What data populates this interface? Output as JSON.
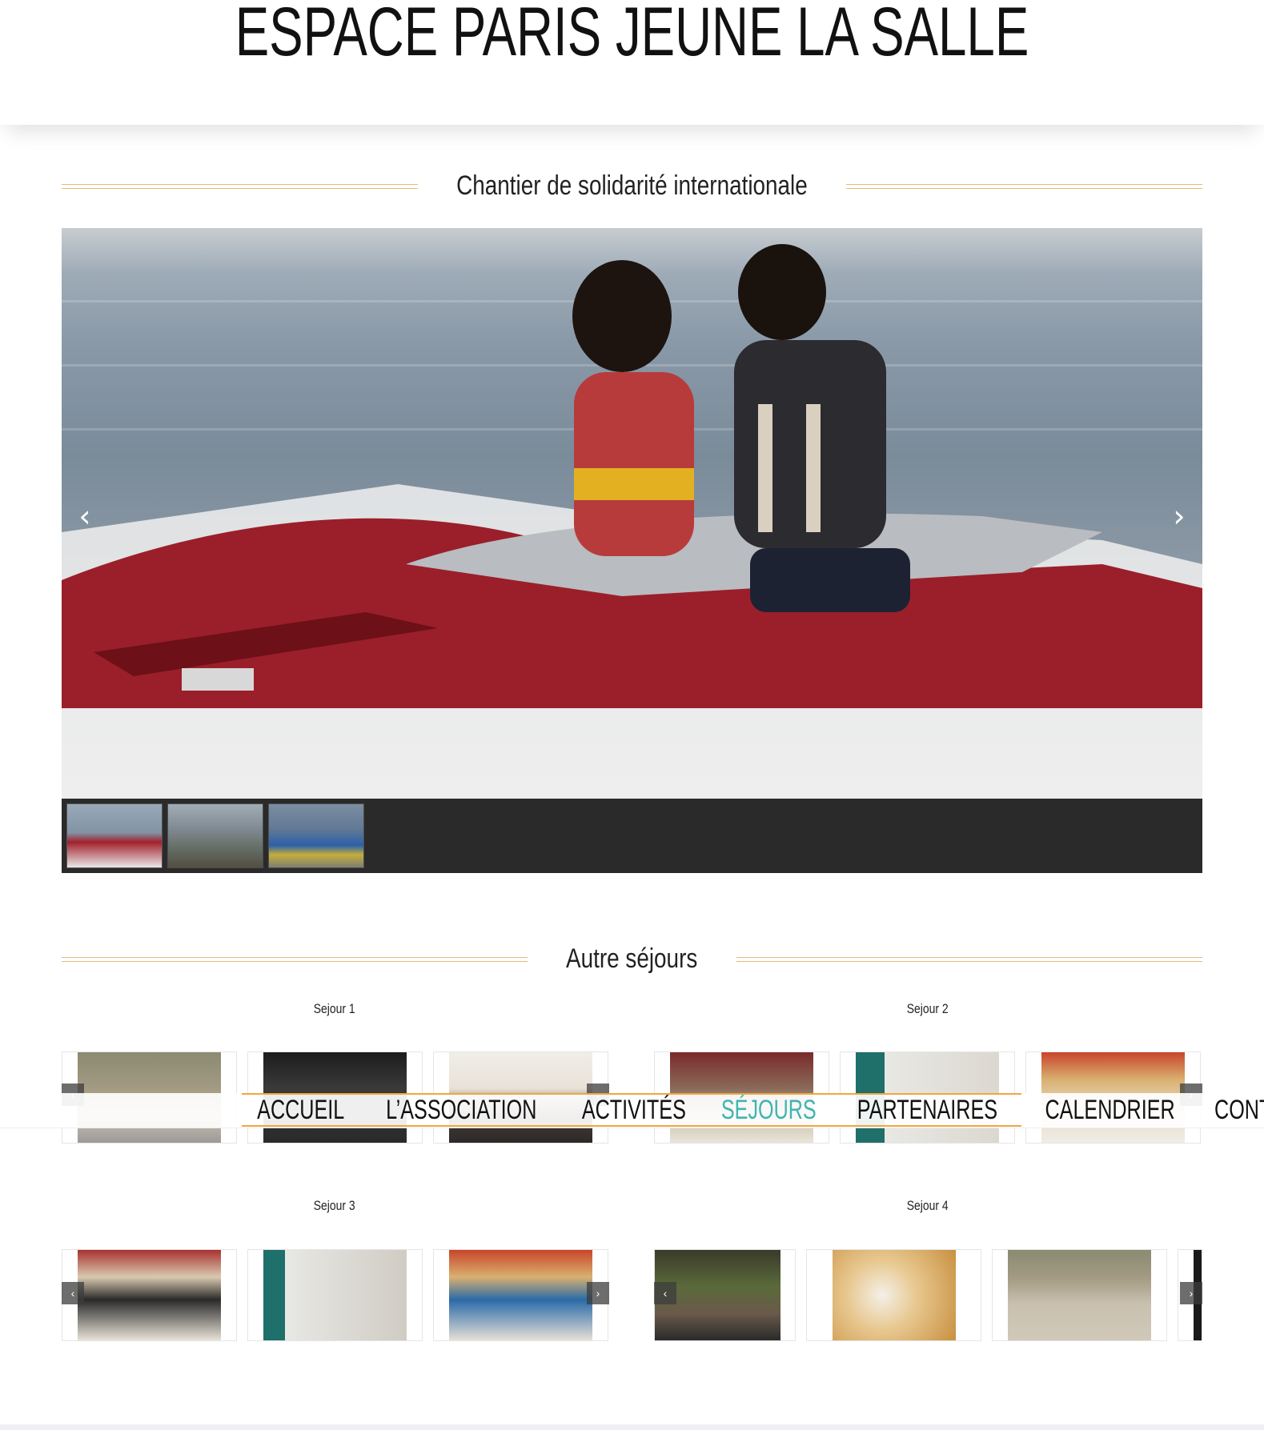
{
  "site": {
    "title": "ESPACE PARIS JEUNE LA SALLE"
  },
  "section1": {
    "heading": "Chantier de solidarité internationale"
  },
  "hero": {
    "prev_icon": "chevron-left-icon",
    "next_icon": "chevron-right-icon",
    "prev_glyph": "‹",
    "next_glyph": "›",
    "thumbnails": 3
  },
  "section2": {
    "heading": "Autre séjours"
  },
  "sejours": [
    {
      "label": "Sejour 1"
    },
    {
      "label": "Sejour 2"
    },
    {
      "label": "Sejour 3"
    },
    {
      "label": "Sejour 4"
    }
  ],
  "nav": {
    "items": [
      "ACCUEIL",
      "L’ASSOCIATION",
      "ACTIVITÉS",
      "SÉJOURS",
      "PARTENAIRES",
      "CALENDRIER",
      "CONTACT"
    ],
    "active": "SÉJOURS"
  },
  "colors": {
    "accent_line": "#e6b97a",
    "nav_border": "#f0a640",
    "nav_active": "#3fb5b0"
  }
}
